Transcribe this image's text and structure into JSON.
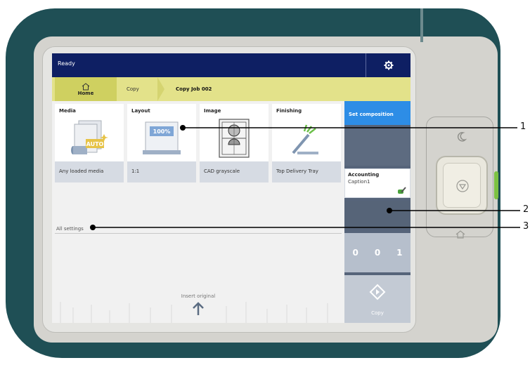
{
  "status": {
    "text": "Ready"
  },
  "breadcrumb": {
    "home": "Home",
    "copy": "Copy",
    "job": "Copy Job 002"
  },
  "tiles": [
    {
      "title": "Media",
      "value": "Any loaded media",
      "icon": "media-auto-icon",
      "badge": "AUTO"
    },
    {
      "title": "Layout",
      "value": "1:1",
      "icon": "layout-scale-icon",
      "badge": "100%"
    },
    {
      "title": "Image",
      "value": "CAD grayscale",
      "icon": "image-cad-icon"
    },
    {
      "title": "Finishing",
      "value": "Top Delivery Tray",
      "icon": "finishing-tray-icon"
    }
  ],
  "all_settings": "All settings",
  "insert_original": "Insert original",
  "right_panel": {
    "set_composition": "Set composition",
    "accounting_title": "Accounting",
    "accounting_caption": "Caption1",
    "counter_digits": [
      "0",
      "0",
      "1"
    ],
    "copy_label": "Copy"
  },
  "callouts": [
    "1",
    "2",
    "3"
  ],
  "colors": {
    "bezel": "#1f4f55",
    "statusbar": "#0e1f63",
    "breadcrumb": "#e3e28a",
    "accent": "#2d8de6",
    "led": "#7cc242"
  }
}
